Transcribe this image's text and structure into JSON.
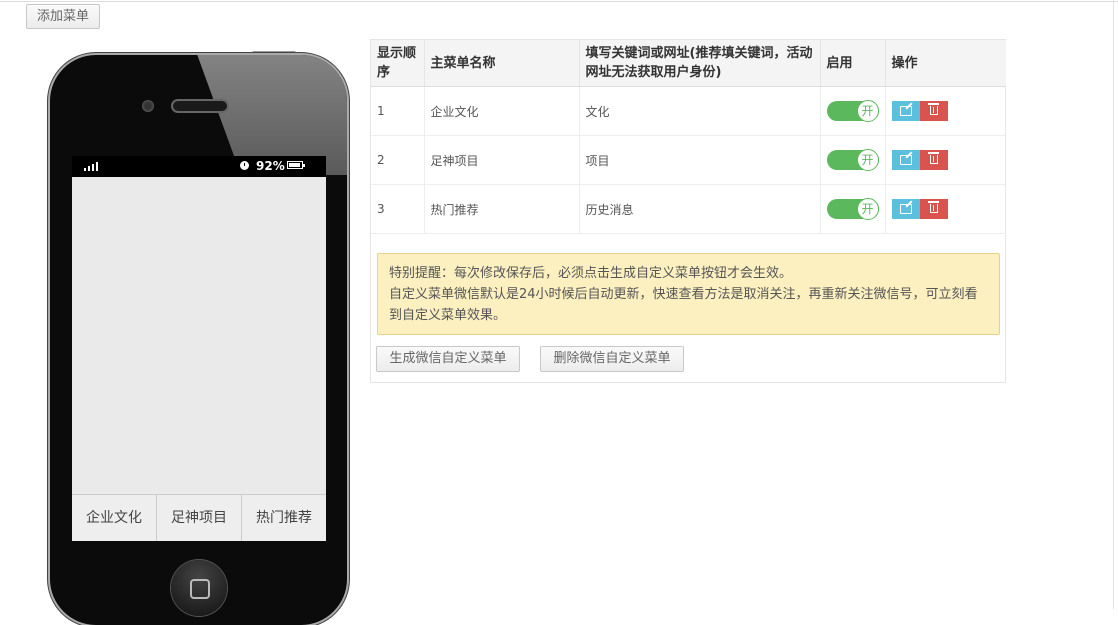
{
  "toolbar": {
    "add_menu_label": "添加菜单"
  },
  "phone": {
    "battery_percent": "92%",
    "menu_items": [
      "企业文化",
      "足神项目",
      "热门推荐"
    ]
  },
  "table": {
    "headers": {
      "order": "显示顺序",
      "name": "主菜单名称",
      "keyword": "填写关键词或网址(推荐填关键词，活动网址无法获取用户身份)",
      "enabled": "启用",
      "actions": "操作"
    },
    "rows": [
      {
        "order": "1",
        "name": "企业文化",
        "keyword": "文化",
        "toggle": "开"
      },
      {
        "order": "2",
        "name": "足神项目",
        "keyword": "项目",
        "toggle": "开"
      },
      {
        "order": "3",
        "name": "热门推荐",
        "keyword": "历史消息",
        "toggle": "开"
      }
    ]
  },
  "notice": {
    "line1": "特别提醒：每次修改保存后，必须点击生成自定义菜单按钮才会生效。",
    "line2": "自定义菜单微信默认是24小时候后自动更新，快速查看方法是取消关注，再重新关注微信号，可立刻看到自定义菜单效果。"
  },
  "buttons": {
    "generate": "生成微信自定义菜单",
    "delete": "删除微信自定义菜单"
  },
  "colors": {
    "toggle_on": "#5cb85c",
    "edit": "#5bc0de",
    "delete": "#d9534f",
    "notice_bg": "#fcefc0"
  }
}
